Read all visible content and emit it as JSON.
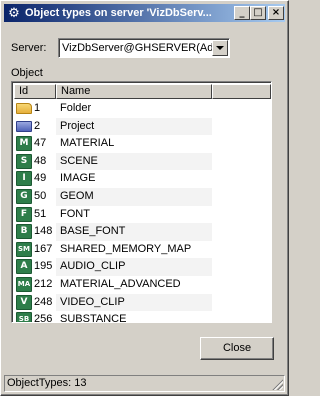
{
  "window": {
    "title": "Object types on server 'VizDbServ...",
    "icon": "gear-icon",
    "controls": {
      "minimize": "_",
      "maximize": "□",
      "close": "×"
    }
  },
  "server": {
    "label": "Server:",
    "value": "VizDbServer@GHSERVER(Admin"
  },
  "object_group_label": "Object",
  "table": {
    "columns": [
      "Id",
      "Name",
      ""
    ],
    "rows": [
      {
        "icon": "folder-icon",
        "icon_text": "",
        "id": "1",
        "name": "Folder"
      },
      {
        "icon": "project-icon",
        "icon_text": "",
        "id": "2",
        "name": "Project"
      },
      {
        "icon": "material-icon",
        "icon_text": "M",
        "id": "47",
        "name": "MATERIAL"
      },
      {
        "icon": "scene-icon",
        "icon_text": "S",
        "id": "48",
        "name": "SCENE"
      },
      {
        "icon": "image-icon",
        "icon_text": "I",
        "id": "49",
        "name": "IMAGE"
      },
      {
        "icon": "geom-icon",
        "icon_text": "G",
        "id": "50",
        "name": "GEOM"
      },
      {
        "icon": "font-icon",
        "icon_text": "F",
        "id": "51",
        "name": "FONT"
      },
      {
        "icon": "base-font-icon",
        "icon_text": "B",
        "id": "148",
        "name": "BASE_FONT"
      },
      {
        "icon": "shared-memory-map-icon",
        "icon_text": "SM",
        "id": "167",
        "name": "SHARED_MEMORY_MAP"
      },
      {
        "icon": "audio-clip-icon",
        "icon_text": "A",
        "id": "195",
        "name": "AUDIO_CLIP"
      },
      {
        "icon": "material-advanced-icon",
        "icon_text": "MA",
        "id": "212",
        "name": "MATERIAL_ADVANCED"
      },
      {
        "icon": "video-clip-icon",
        "icon_text": "V",
        "id": "248",
        "name": "VIDEO_CLIP"
      },
      {
        "icon": "substance-icon",
        "icon_text": "SB",
        "id": "256",
        "name": "SUBSTANCE"
      }
    ]
  },
  "close_button": "Close",
  "status": "ObjectTypes: 13"
}
